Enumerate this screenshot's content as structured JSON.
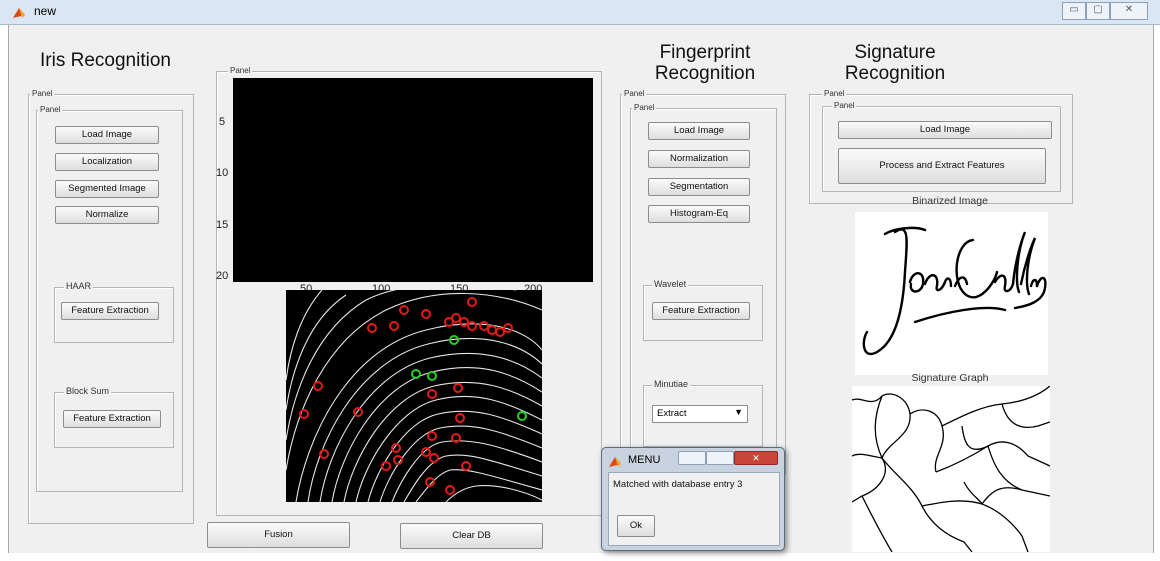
{
  "window": {
    "title": "new",
    "minimize": "▭",
    "maximize": "▢",
    "close": "✕"
  },
  "iris": {
    "title": "Iris Recognition",
    "outer_panel_label": "Panel",
    "inner_panel_label": "Panel",
    "buttons": [
      "Load Image",
      "Localization",
      "Segmented Image",
      "Normalize"
    ],
    "haar": {
      "label": "HAAR",
      "button": "Feature Extraction"
    },
    "block_sum": {
      "label": "Block Sum",
      "button": "Feature Extraction"
    }
  },
  "center": {
    "panel_label": "Panel",
    "y_ticks": [
      "5",
      "10",
      "15",
      "20"
    ],
    "x_ticks": [
      "50",
      "100",
      "150",
      "200"
    ],
    "fusion_button": "Fusion",
    "clear_db_button": "Clear DB"
  },
  "fingerprint": {
    "title_line1": "Fingerprint",
    "title_line2": "Recognition",
    "outer_panel_label": "Panel",
    "inner_panel_label": "Panel",
    "buttons": [
      "Load Image",
      "Normalization",
      "Segmentation",
      "Histogram-Eq"
    ],
    "wavelet": {
      "label": "Wavelet",
      "button": "Feature Extraction"
    },
    "minutiae": {
      "label": "Minutiae",
      "select_value": "Extract"
    }
  },
  "signature": {
    "title_line1": "Signature",
    "title_line2": "Recognition",
    "outer_panel_label": "Panel",
    "inner_panel_label": "Panel",
    "load_button": "Load Image",
    "process_button": "Process and Extract Features",
    "binarized_label": "Binarized Image",
    "signature_text": "Joan Collins",
    "graph_label": "Signature Graph"
  },
  "dialog": {
    "title": "MENU",
    "message": "Matched with database entry 3",
    "ok": "Ok",
    "accent_color": "#c9d3e0",
    "close_color": "#c9453a"
  },
  "colors": {
    "minutia_red": "#e31a1a",
    "minutia_green": "#21d321",
    "ridge": "#ffffff",
    "background": "#f0f0f0"
  }
}
